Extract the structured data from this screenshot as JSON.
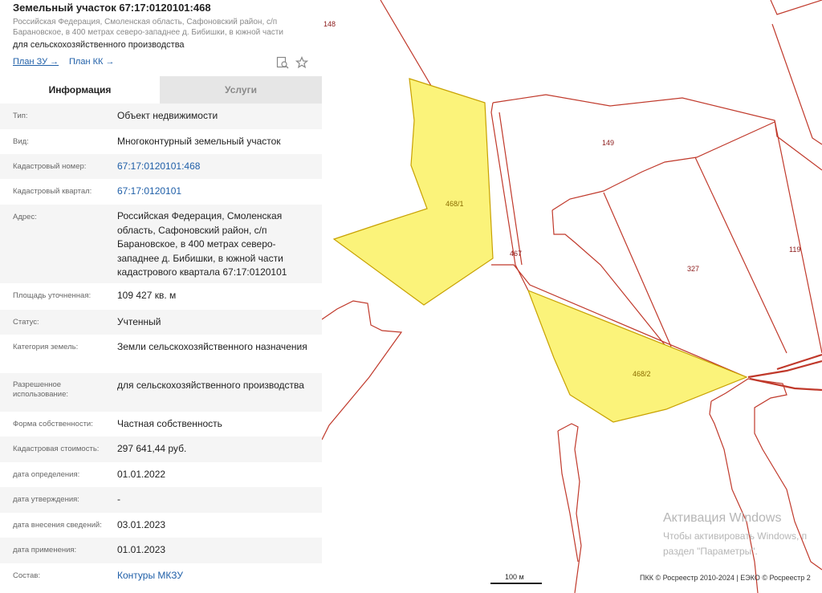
{
  "panel": {
    "title": "Земельный участок 67:17:0120101:468",
    "address_short_1": "Российская Федерация, Смоленская область, Сафоновский район, с/п",
    "address_short_2": "Барановское, в 400 метрах северо-западнее д. Бибишки, в южной части",
    "purpose": "для сельскохозяйственного производства",
    "link_zu": "План ЗУ →",
    "link_kk": "План КК →",
    "tabs": [
      "Информация",
      "Услуги"
    ],
    "rows": [
      {
        "label": "Тип:",
        "value": "Объект недвижимости"
      },
      {
        "label": "Вид:",
        "value": "Многоконтурный земельный участок"
      },
      {
        "label": "Кадастровый номер:",
        "value": "67:17:0120101:468"
      },
      {
        "label": "Кадастровый квартал:",
        "value": "67:17:0120101"
      },
      {
        "label": "Адрес:",
        "value": "Российская Федерация, Смоленская область, Сафоновский район, с/п Барановское, в 400 метрах северо-западнее д. Бибишки, в южной части кадастрового квартала 67:17:0120101"
      },
      {
        "label": "Площадь уточненная:",
        "value": "109 427 кв. м"
      },
      {
        "label": "Статус:",
        "value": "Учтенный"
      },
      {
        "label": "Категория земель:",
        "value": "Земли сельскохозяйственного назначения"
      },
      {
        "label": "Разрешенное использование:",
        "value": "для сельскохозяйственного производства"
      },
      {
        "label": "Форма собственности:",
        "value": "Частная собственность"
      },
      {
        "label": "Кадастровая стоимость:",
        "value": "297 641,44 руб."
      },
      {
        "label": "дата определения:",
        "value": "01.01.2022"
      },
      {
        "label": "дата утверждения:",
        "value": "-"
      },
      {
        "label": "дата внесения сведений:",
        "value": "03.01.2023"
      },
      {
        "label": "дата применения:",
        "value": "01.01.2023"
      },
      {
        "label": "Состав:",
        "value": "Контуры МКЗУ"
      }
    ]
  },
  "map": {
    "labels": {
      "p148": "148",
      "p149": "149",
      "p119": "119",
      "p327": "327",
      "p467": "467",
      "p468_1": "468/1",
      "p468_2": "468/2"
    },
    "scale": "100 м",
    "copyright": "ПКК © Росреестр 2010-2024 | ЕЭКО © Росреестр 2",
    "watermark_title": "Активация Windows",
    "watermark_line1": "Чтобы активировать Windows, п",
    "watermark_line2": "раздел \"Параметры\".",
    "colors": {
      "boundary": "#c0392b",
      "parcel_fill": "#fbf37a",
      "parcel_stroke": "#c8a100",
      "link": "#1f5fa8"
    }
  }
}
